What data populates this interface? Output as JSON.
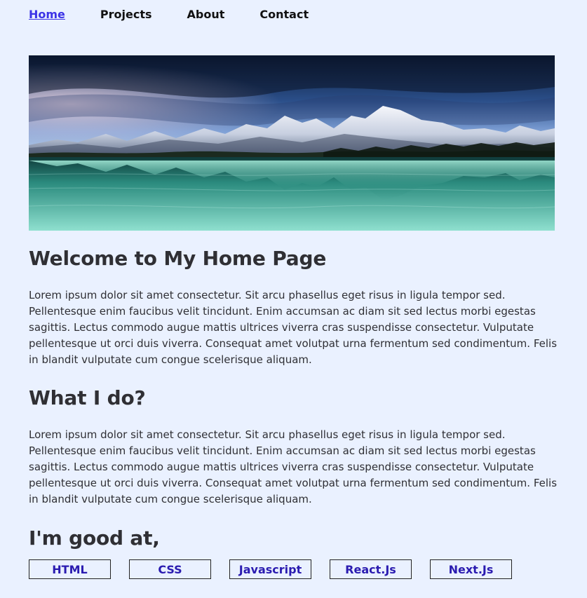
{
  "nav": {
    "items": [
      {
        "label": "Home",
        "active": true
      },
      {
        "label": "Projects",
        "active": false
      },
      {
        "label": "About",
        "active": false
      },
      {
        "label": "Contact",
        "active": false
      }
    ]
  },
  "hero": {
    "icon": "mountain-lake-image"
  },
  "main": {
    "welcome_title": "Welcome to My Home Page",
    "welcome_text": "Lorem ipsum dolor sit amet consectetur. Sit arcu phasellus eget risus in ligula tempor sed. Pellentesque enim faucibus velit tincidunt. Enim accumsan ac diam sit sed lectus morbi egestas sagittis. Lectus commodo augue mattis ultrices viverra cras suspendisse consectetur. Vulputate pellentesque ut orci duis viverra. Consequat amet volutpat urna fermentum sed condimentum. Felis in blandit vulputate cum congue scelerisque aliquam.",
    "whatido_title": "What I do?",
    "whatido_text": "Lorem ipsum dolor sit amet consectetur. Sit arcu phasellus eget risus in ligula tempor sed. Pellentesque enim faucibus velit tincidunt. Enim accumsan ac diam sit sed lectus morbi egestas sagittis. Lectus commodo augue mattis ultrices viverra cras suspendisse consectetur. Vulputate pellentesque ut orci duis viverra. Consequat amet volutpat urna fermentum sed condimentum. Felis in blandit vulputate cum congue scelerisque aliquam.",
    "goodat_title": "I'm good at,"
  },
  "skills": [
    "HTML",
    "CSS",
    "Javascript",
    "React.Js",
    "Next.Js"
  ],
  "colors": {
    "background": "#eaf1ff",
    "accent": "#3c33e6",
    "skill_text": "#2a1bb0"
  }
}
